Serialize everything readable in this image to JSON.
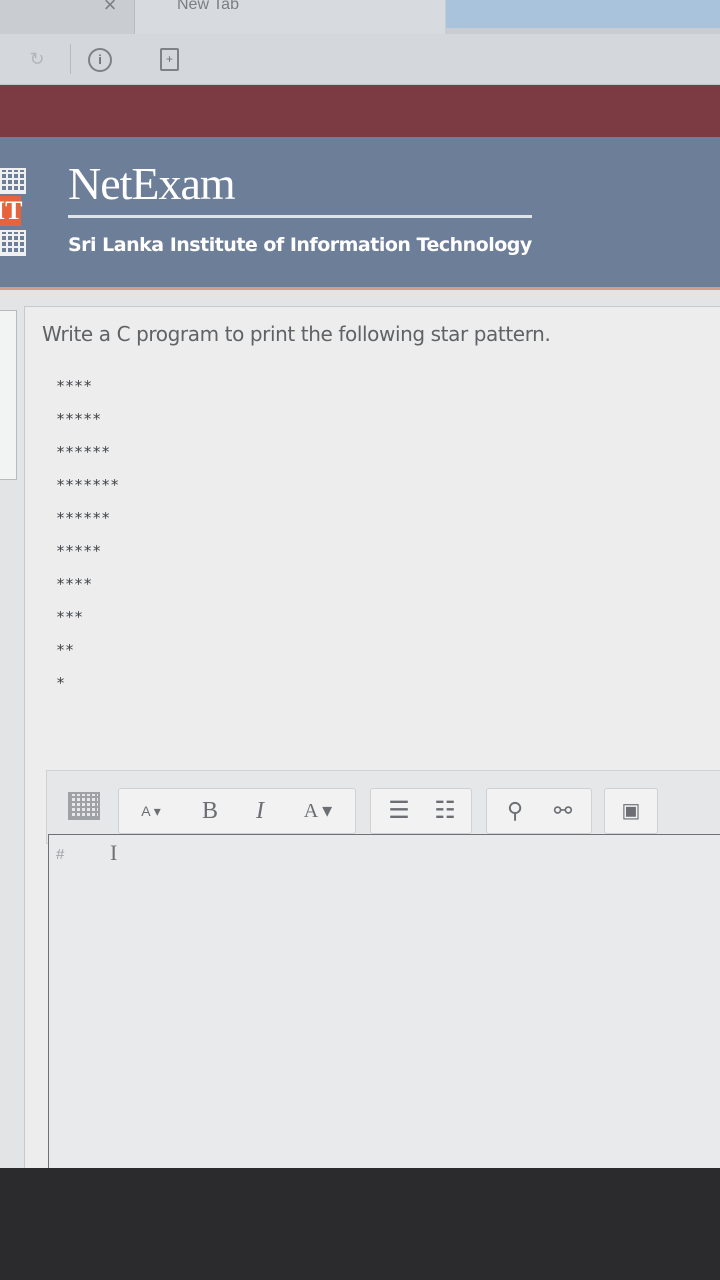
{
  "browser": {
    "tab_close_glyph": "×",
    "tab_title": "New Tab",
    "reload_glyph": "↻",
    "info_glyph": "i",
    "page_glyph": "+"
  },
  "site": {
    "brand": "NetExam",
    "institute": "Sri Lanka Institute of Information Technology",
    "logo_text": "IT"
  },
  "question": {
    "prompt": "Write a C program to print the following star pattern.",
    "pattern_rows": [
      "****",
      "*****",
      "******",
      "*******",
      "******",
      "*****",
      "****",
      "***",
      "**",
      "*"
    ]
  },
  "editor": {
    "font_size_label": "A",
    "bold_label": "B",
    "italic_label": "I",
    "font_color_label": "A",
    "content": "#"
  },
  "colors": {
    "maroon_bar": "#7c3b42",
    "banner": "#6d7e99",
    "accent_line": "#cfa083"
  }
}
